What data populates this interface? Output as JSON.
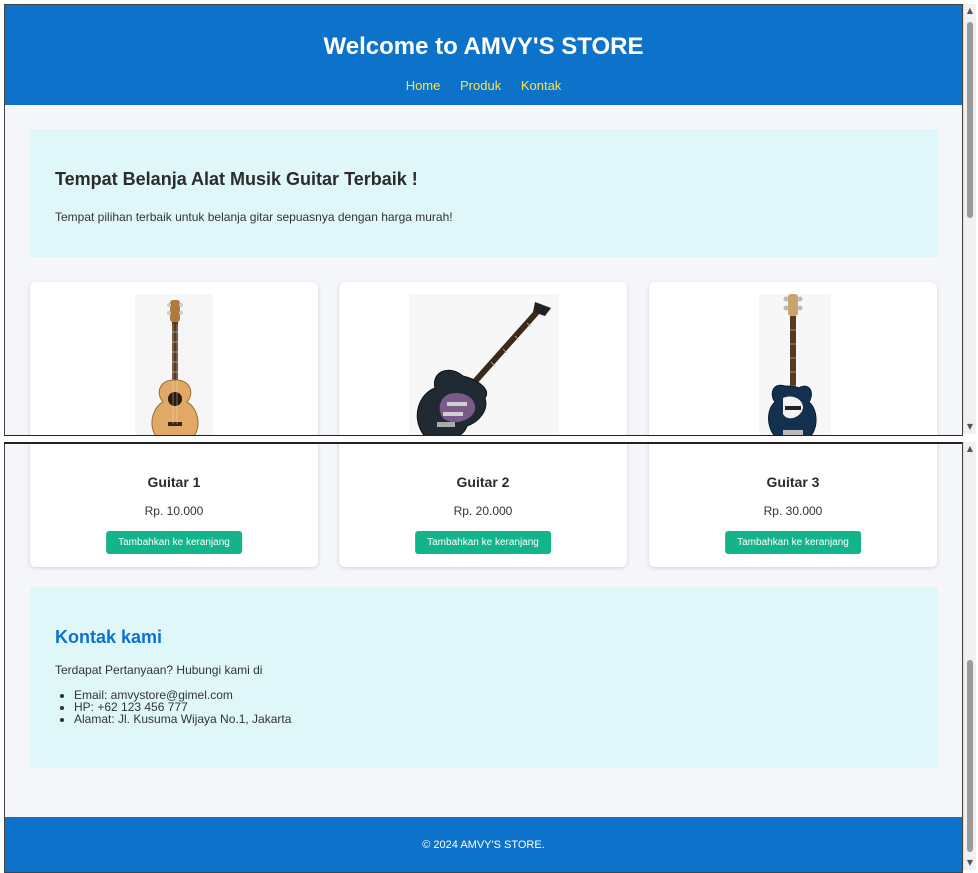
{
  "header": {
    "title": "Welcome to AMVY'S STORE",
    "nav": [
      "Home",
      "Produk",
      "Kontak"
    ]
  },
  "hero": {
    "heading": "Tempat Belanja Alat Musik Guitar Terbaik !",
    "text": "Tempat pilihan terbaik untuk belanja gitar sepuasnya dengan harga murah!"
  },
  "products": [
    {
      "name": "Guitar 1",
      "price": "Rp. 10.000",
      "button": "Tambahkan ke keranjang",
      "image_icon": "acoustic-guitar-icon"
    },
    {
      "name": "Guitar 2",
      "price": "Rp. 20.000",
      "button": "Tambahkan ke keranjang",
      "image_icon": "electric-guitar-icon"
    },
    {
      "name": "Guitar 3",
      "price": "Rp. 30.000",
      "button": "Tambahkan ke keranjang",
      "image_icon": "bass-guitar-icon"
    }
  ],
  "contact": {
    "heading": "Kontak kami",
    "lead": "Terdapat Pertanyaan? Hubungi kami di",
    "items": [
      "Email: amvystore@gimel.com",
      "HP: +62 123 456 777",
      "Alamat: Jl. Kusuma Wijaya No.1, Jakarta"
    ]
  },
  "footer": {
    "copyright": "© 2024 AMVY'S STORE."
  },
  "colors": {
    "header_bg": "#0d72c9",
    "nav_link": "#ffe14d",
    "panel_bg": "#dff7f9",
    "button_bg": "#14b48a",
    "page_bg": "#f4f6f9"
  }
}
